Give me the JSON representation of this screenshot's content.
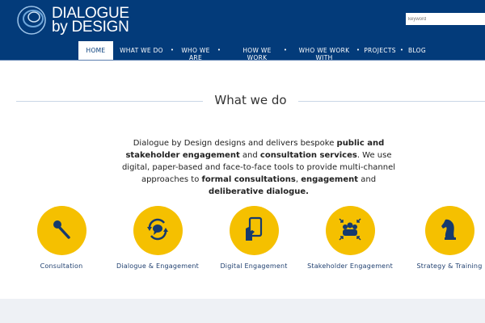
{
  "header": {
    "logo_line1": "DIALOGUE",
    "logo_line2": "by DESIGN",
    "search_placeholder": "keyword"
  },
  "nav": [
    "HOME",
    "WHAT WE DO",
    "WHO WE ARE",
    "HOW WE WORK",
    "WHO WE WORK WITH",
    "PROJECTS",
    "BLOG"
  ],
  "main": {
    "title": "What we do",
    "intro": [
      {
        "t": "Dialogue by Design designs and delivers bespoke ",
        "b": false
      },
      {
        "t": "public and stakeholder engagement",
        "b": true
      },
      {
        "t": " and ",
        "b": false
      },
      {
        "t": "consultation services",
        "b": true
      },
      {
        "t": ". We use digital, paper-based and face-to-face tools to provide multi-channel approaches to ",
        "b": false
      },
      {
        "t": "formal consultations",
        "b": true
      },
      {
        "t": ", ",
        "b": false
      },
      {
        "t": "engagement",
        "b": true
      },
      {
        "t": " and ",
        "b": false
      },
      {
        "t": "deliberative dialogue.",
        "b": true
      }
    ],
    "services": [
      {
        "label": "Consultation",
        "icon": "microphone-icon"
      },
      {
        "label": "Dialogue & Engagement",
        "icon": "chat-cycle-icon"
      },
      {
        "label": "Digital Engagement",
        "icon": "tablet-hand-icon"
      },
      {
        "label": "Stakeholder Engagement",
        "icon": "group-icon"
      },
      {
        "label": "Strategy & Training",
        "icon": "chess-knight-icon"
      }
    ]
  },
  "colors": {
    "brand": "#033b7a",
    "accent": "#f5c000"
  }
}
